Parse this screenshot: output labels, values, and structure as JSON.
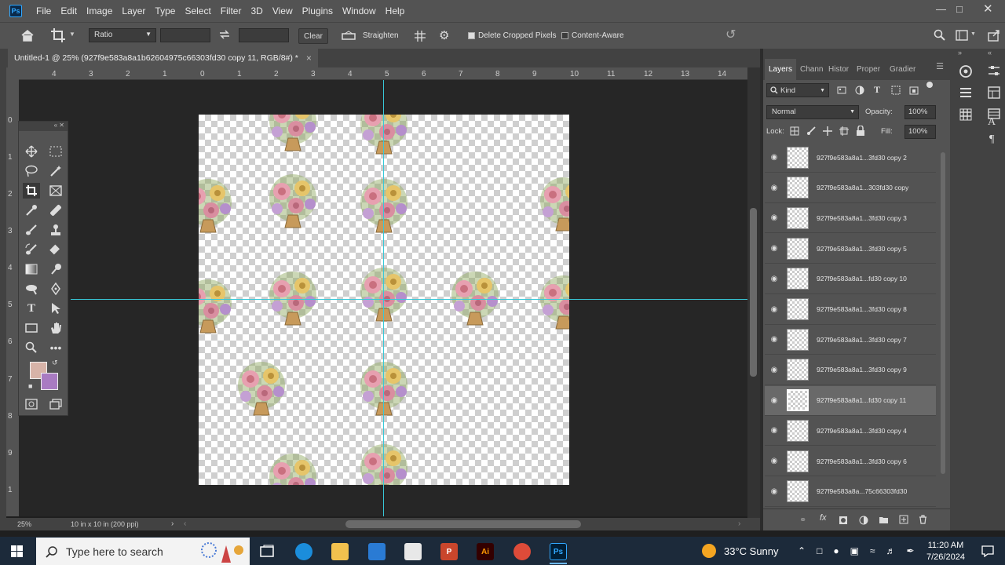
{
  "app": {
    "logo": "Ps",
    "menu": [
      "File",
      "Edit",
      "Image",
      "Layer",
      "Type",
      "Select",
      "Filter",
      "3D",
      "View",
      "Plugins",
      "Window",
      "Help"
    ]
  },
  "options": {
    "ratio_label": "Ratio",
    "clear_label": "Clear",
    "straighten_label": "Straighten",
    "delete_cropped_label": "Delete Cropped Pixels",
    "delete_cropped_checked": true,
    "content_aware_label": "Content-Aware",
    "content_aware_checked": false
  },
  "document": {
    "tab_title": "Untitled-1 @ 25% (927f9e583a8a1b62604975c66303fd30 copy 11, RGB/8#) *",
    "close_glyph": "×"
  },
  "rulers": {
    "h_ticks": [
      "4",
      "3",
      "2",
      "1",
      "0",
      "1",
      "2",
      "3",
      "4",
      "5",
      "6",
      "7",
      "8",
      "9",
      "10",
      "11",
      "12",
      "13",
      "14"
    ],
    "v_ticks": [
      "0",
      "1",
      "2",
      "3",
      "4",
      "5",
      "6",
      "7",
      "8",
      "9",
      "1"
    ]
  },
  "status": {
    "zoom": "25%",
    "doc_size": "10 in x 10 in (200 ppi)"
  },
  "panel": {
    "tabs": [
      "Layers",
      "Chann",
      "Histor",
      "Proper",
      "Gradier"
    ],
    "filter_kind": "Kind",
    "blend_mode": "Normal",
    "opacity_label": "Opacity:",
    "opacity_value": "100%",
    "lock_label": "Lock:",
    "fill_label": "Fill:",
    "fill_value": "100%",
    "layers": [
      {
        "name": "927f9e583a8a1...3fd30 copy 2",
        "selected": false
      },
      {
        "name": "927f9e583a8a1...303fd30 copy",
        "selected": false
      },
      {
        "name": "927f9e583a8a1...3fd30 copy 3",
        "selected": false
      },
      {
        "name": "927f9e583a8a1...3fd30 copy 5",
        "selected": false
      },
      {
        "name": "927f9e583a8a1...fd30 copy 10",
        "selected": false
      },
      {
        "name": "927f9e583a8a1...3fd30 copy 8",
        "selected": false
      },
      {
        "name": "927f9e583a8a1...3fd30 copy 7",
        "selected": false
      },
      {
        "name": "927f9e583a8a1...3fd30 copy 9",
        "selected": false
      },
      {
        "name": "927f9e583a8a1...fd30 copy 11",
        "selected": true
      },
      {
        "name": "927f9e583a8a1...3fd30 copy 4",
        "selected": false
      },
      {
        "name": "927f9e583a8a1...3fd30 copy 6",
        "selected": false
      },
      {
        "name": "927f9e583a8a...75c66303fd30",
        "selected": false
      }
    ]
  },
  "colors": {
    "foreground": "#d7b3a8",
    "background": "#a97bc2",
    "guide": "#38c8d8",
    "selection_row": "#696969"
  },
  "taskbar": {
    "search_placeholder": "Type here to search",
    "weather": "33°C  Sunny",
    "time": "11:20 AM",
    "date": "7/26/2024",
    "pinned": [
      "Ai",
      "Ps"
    ]
  }
}
